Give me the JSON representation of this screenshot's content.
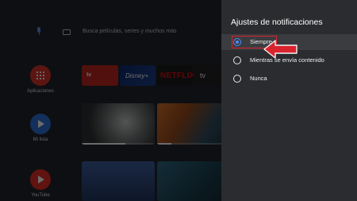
{
  "home": {
    "search_placeholder": "Busca películas, series y muchos más",
    "side_apps": [
      {
        "label": "Aplicaciones",
        "icon": "apps-grid-icon"
      },
      {
        "label": "Mi lista",
        "icon": "play-icon"
      },
      {
        "label": "YouTube",
        "icon": "youtube-icon"
      }
    ],
    "app_tiles": [
      "tv",
      "Disney+",
      "NETFLIX",
      "tv"
    ]
  },
  "panel": {
    "title": "Ajustes de notificaciones",
    "options": [
      {
        "label": "Siempre",
        "selected": true
      },
      {
        "label": "Mientras se envía contenido",
        "selected": false
      },
      {
        "label": "Nunca",
        "selected": false
      }
    ]
  },
  "colors": {
    "panel_bg": "#2b2c2f",
    "accent": "#4d8ef7",
    "annotation": "#d9232e"
  }
}
